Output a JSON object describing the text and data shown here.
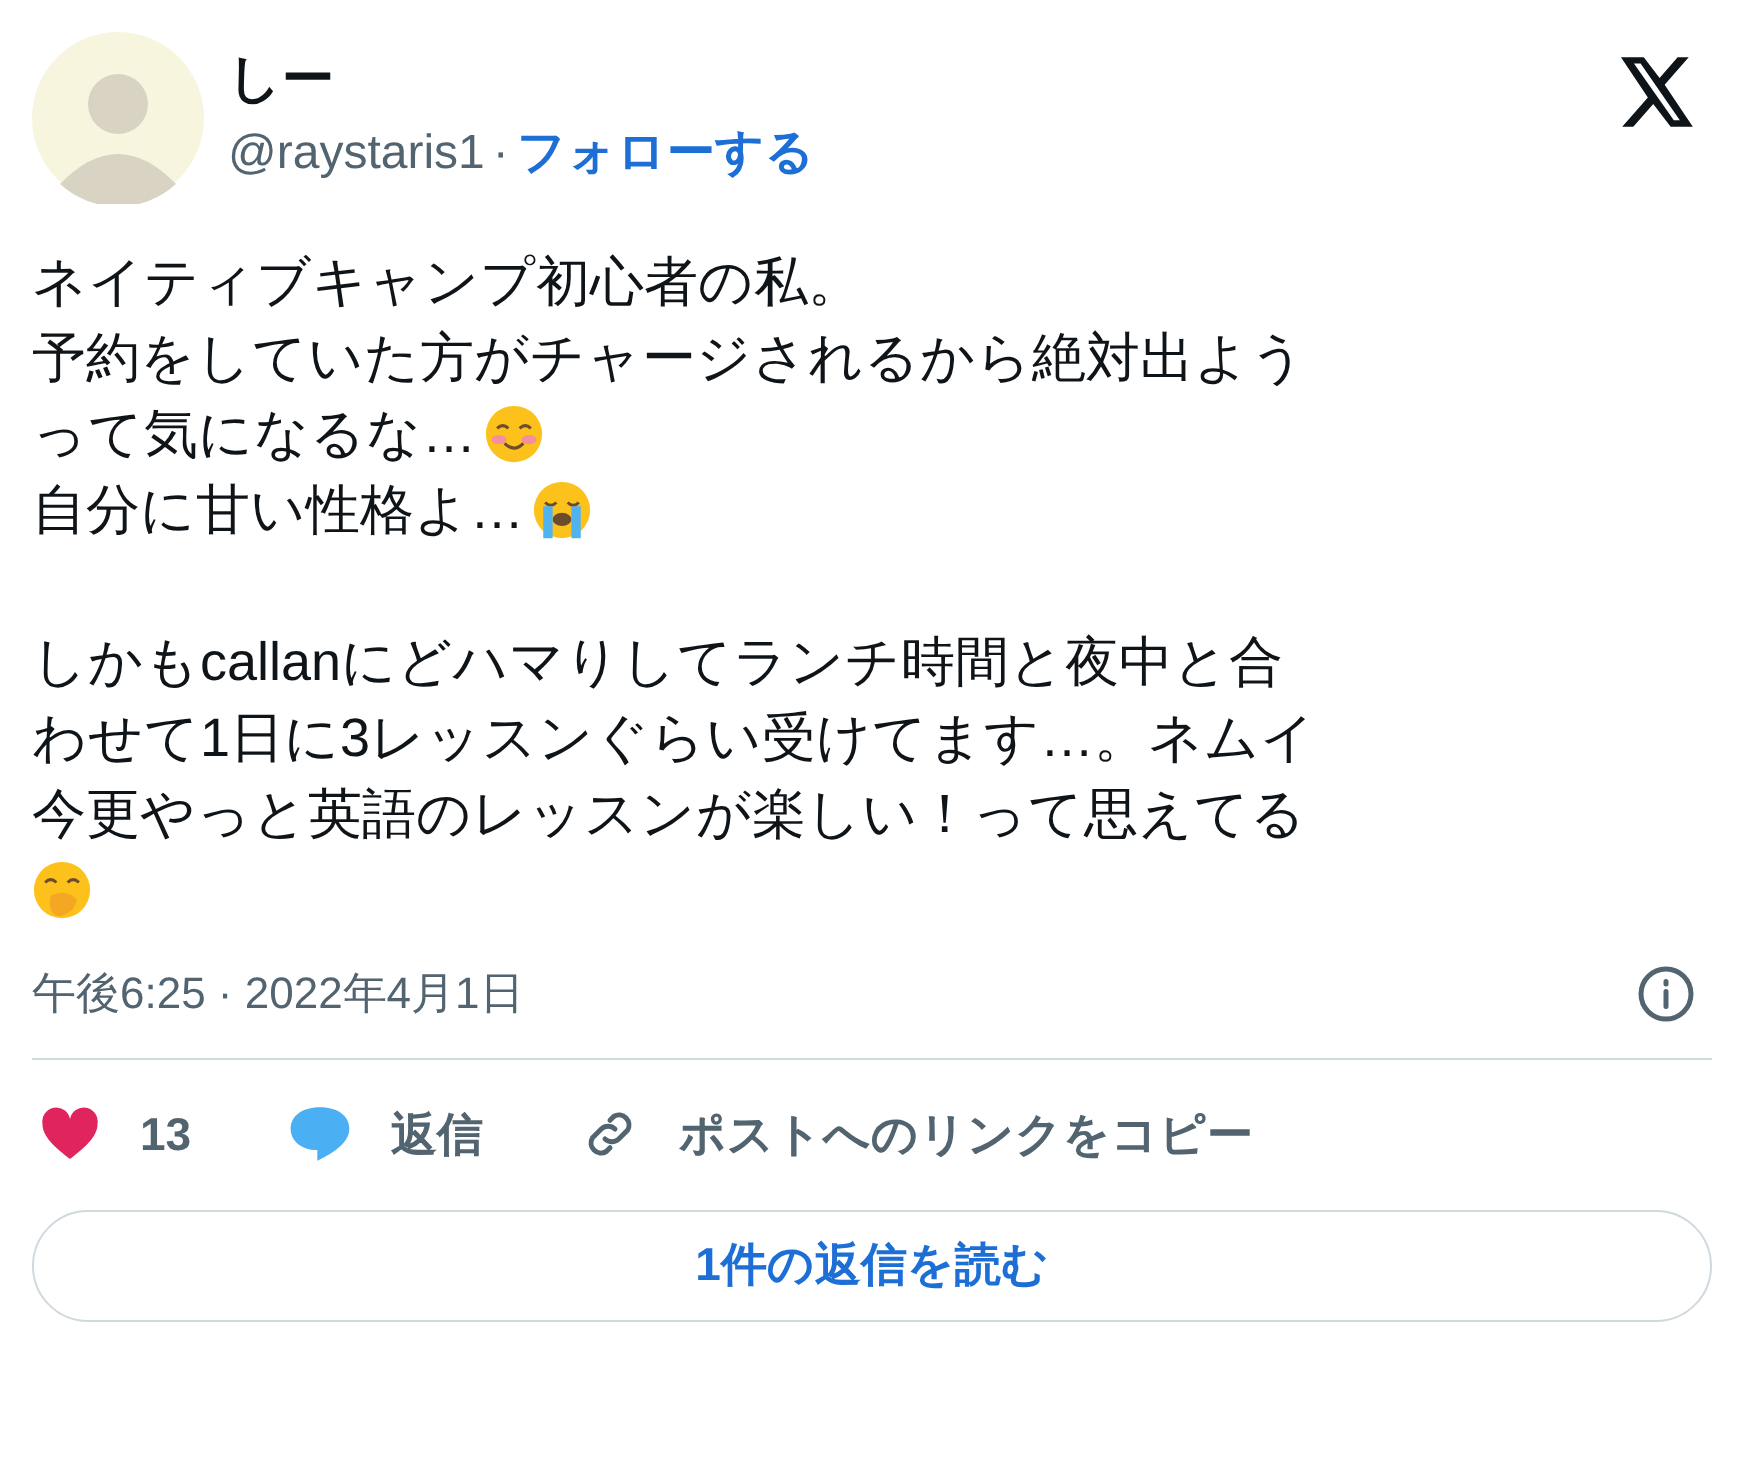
{
  "author": {
    "name": "しー",
    "handle": "@raystaris1",
    "separator": "·",
    "follow": "フォローする"
  },
  "body": [
    {
      "kind": "plain",
      "text": "ネイティブキャンプ初心者の私。"
    },
    {
      "kind": "plain",
      "text": "予約をしていた方がチャージされるから絶対出よう"
    },
    {
      "kind": "blush",
      "text": "って気になるな…"
    },
    {
      "kind": "cry",
      "text": "自分に甘い性格よ…"
    },
    {
      "kind": "gap"
    },
    {
      "kind": "plain",
      "text": "しかもcallanにどハマりしてランチ時間と夜中と合"
    },
    {
      "kind": "plain",
      "text": "わせて1日に3レッスンぐらい受けてます…。ネムイ"
    },
    {
      "kind": "plain",
      "text": "今更やっと英語のレッスンが楽しい！って思えてる"
    },
    {
      "kind": "hand"
    }
  ],
  "timestamp": "午後6:25 · 2022年4月1日",
  "actions": [
    {
      "kind": "like",
      "label": "13"
    },
    {
      "kind": "reply",
      "label": "返信"
    },
    {
      "kind": "link",
      "label": "ポストへのリンクをコピー"
    }
  ],
  "read_replies": "1件の返信を読む"
}
